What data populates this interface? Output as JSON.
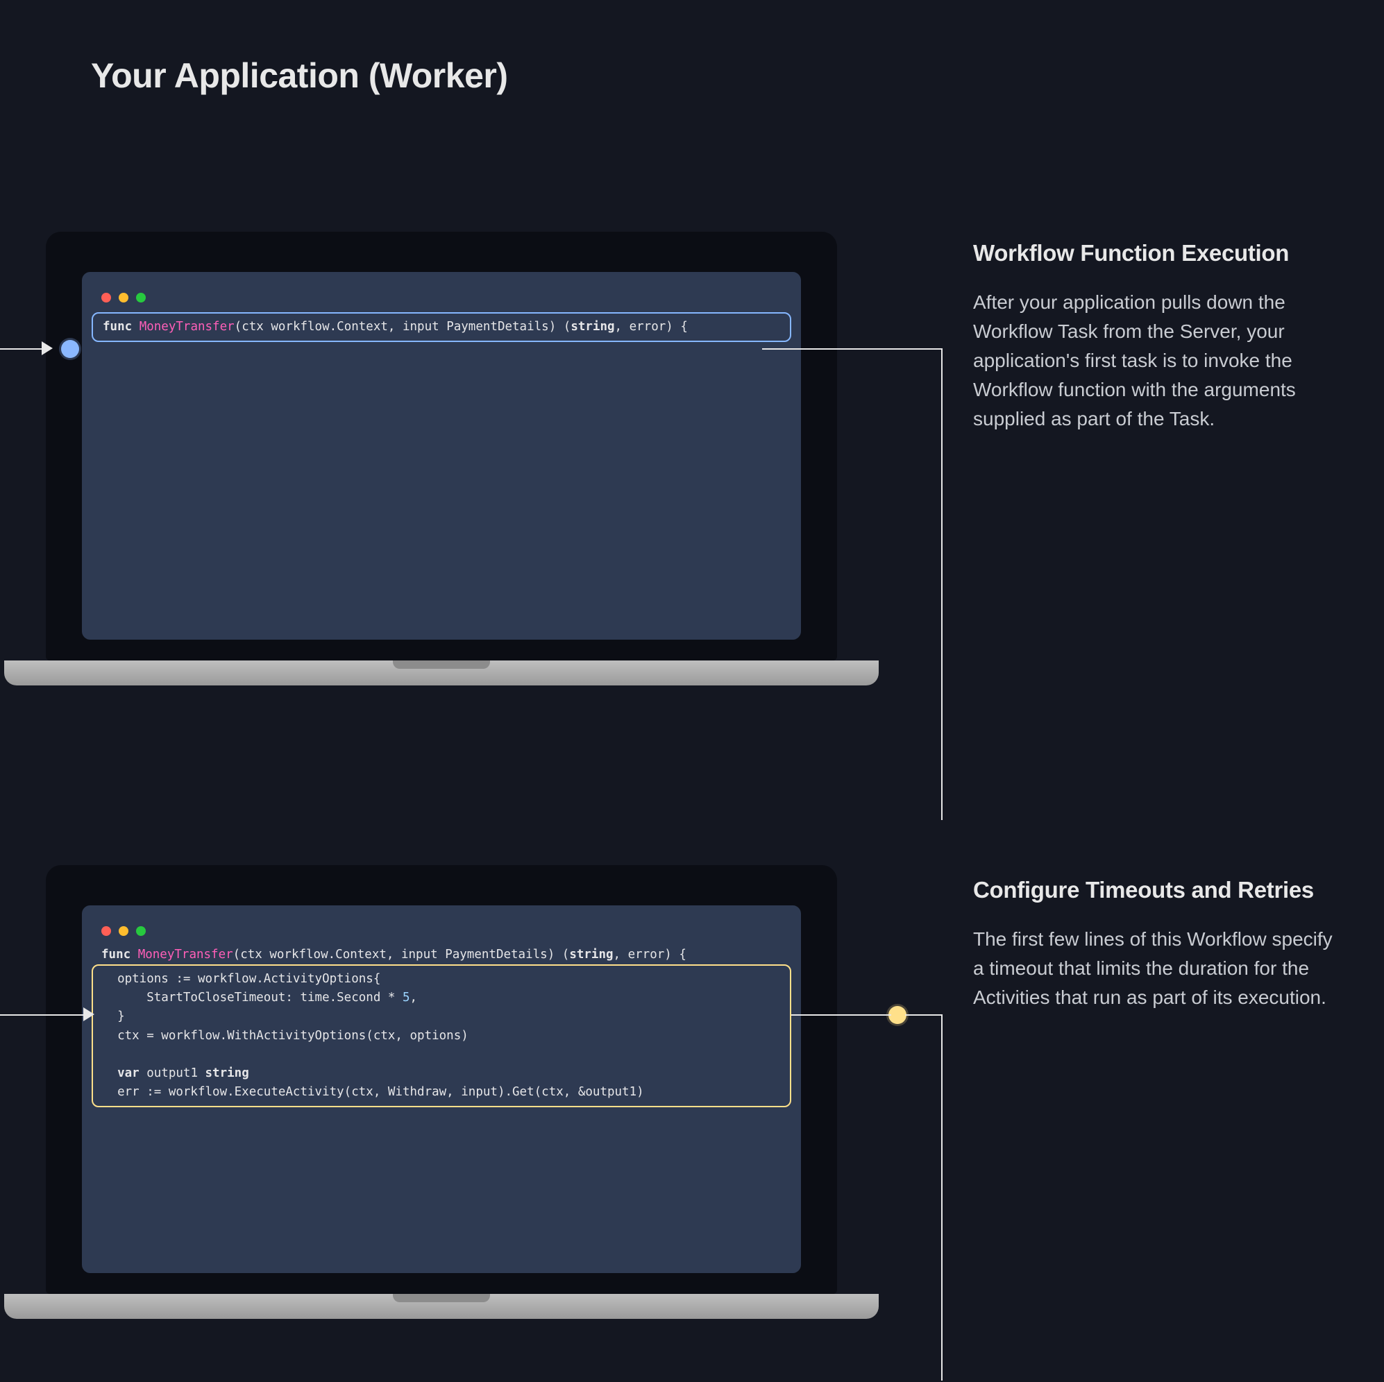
{
  "heading": "Your Application (Worker)",
  "sections": [
    {
      "title": "Workflow Function Execution",
      "body": "After your application pulls down the Workflow Task from the Server, your application's first task is to invoke the Workflow function with the arguments supplied as part of the Task.",
      "highlight_color": "blue",
      "code_lines": [
        {
          "tokens": [
            {
              "t": "func ",
              "c": "kw"
            },
            {
              "t": "MoneyTransfer",
              "c": "fn"
            },
            {
              "t": "(ctx workflow.Context, input PaymentDetails) ("
            },
            {
              "t": "string",
              "c": "kw"
            },
            {
              "t": ", error) {"
            }
          ],
          "highlighted": true
        }
      ]
    },
    {
      "title": "Configure Timeouts and Retries",
      "body": "The first few lines of this Workflow specify a timeout that limits the duration for the Activities that run as part of its execution.",
      "highlight_color": "yellow",
      "code_lines": [
        {
          "tokens": [
            {
              "t": "func ",
              "c": "kw"
            },
            {
              "t": "MoneyTransfer",
              "c": "fn"
            },
            {
              "t": "(ctx workflow.Context, input PaymentDetails) ("
            },
            {
              "t": "string",
              "c": "kw"
            },
            {
              "t": ", error) {"
            }
          ],
          "highlighted": false
        },
        {
          "tokens": [
            {
              "t": "  options := workflow.ActivityOptions{"
            }
          ],
          "highlighted": true
        },
        {
          "tokens": [
            {
              "t": "      StartToCloseTimeout: time.Second * "
            },
            {
              "t": "5",
              "c": "num"
            },
            {
              "t": ","
            }
          ],
          "highlighted": true
        },
        {
          "tokens": [
            {
              "t": "  }"
            }
          ],
          "highlighted": true
        },
        {
          "tokens": [
            {
              "t": "  ctx = workflow.WithActivityOptions(ctx, options)"
            }
          ],
          "highlighted": true
        },
        {
          "tokens": [
            {
              "t": ""
            }
          ],
          "highlighted": true
        },
        {
          "tokens": [
            {
              "t": "  "
            },
            {
              "t": "var",
              "c": "kw"
            },
            {
              "t": " output1 "
            },
            {
              "t": "string",
              "c": "kw"
            }
          ],
          "highlighted": true
        },
        {
          "tokens": [
            {
              "t": "  err := workflow.ExecuteActivity(ctx, Withdraw, input).Get(ctx, &output1)"
            }
          ],
          "highlighted": true
        }
      ]
    }
  ]
}
